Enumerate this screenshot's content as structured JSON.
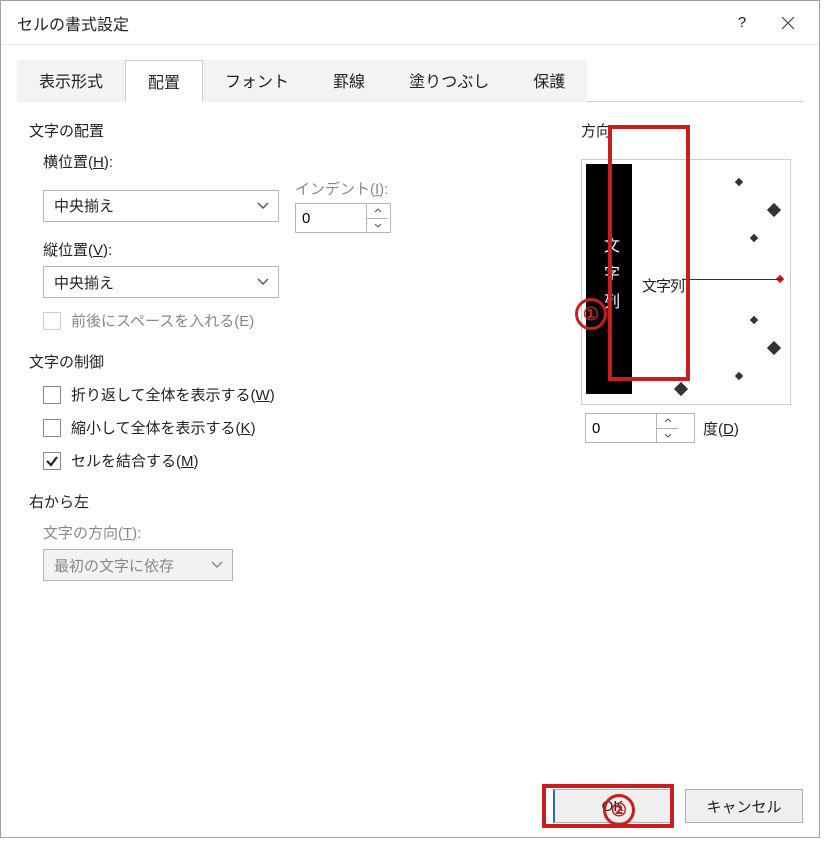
{
  "title": "セルの書式設定",
  "help": "?",
  "tabs": [
    "表示形式",
    "配置",
    "フォント",
    "罫線",
    "塗りつぶし",
    "保護"
  ],
  "activeTab": 1,
  "group": {
    "textAlign": "文字の配置",
    "hLabelPre": "横位置(",
    "hLabelKey": "H",
    "hLabelPost": "):",
    "hValue": "中央揃え",
    "indentLabelPre": "インデント(",
    "indentLabelKey": "I",
    "indentLabelPost": "):",
    "indentValue": "0",
    "vLabelPre": "縦位置(",
    "vLabelKey": "V",
    "vLabelPost": "):",
    "vValue": "中央揃え",
    "spaceLabel": "前後にスペースを入れる(E)",
    "controlTitle": "文字の制御",
    "wrapPre": "折り返して全体を表示する(",
    "wrapKey": "W",
    "wrapPost": ")",
    "shrinkPre": "縮小して全体を表示する(",
    "shrinkKey": "K",
    "shrinkPost": ")",
    "mergePre": "セルを結合する(",
    "mergeKey": "M",
    "mergePost": ")",
    "rtlTitle": "右から左",
    "dirLabelPre": "文字の方向(",
    "dirLabelKey": "T",
    "dirLabelPost": "):",
    "dirValue": "最初の文字に依存"
  },
  "direction": {
    "title": "方向",
    "vertText": "文字列",
    "arcText": "文字列",
    "degree": "0",
    "degreeLabelPre": "度(",
    "degreeLabelKey": "D",
    "degreeLabelPost": ")"
  },
  "annotations": {
    "a1": "①",
    "a2": "②"
  },
  "buttons": {
    "ok": "OK",
    "cancel": "キャンセル"
  }
}
